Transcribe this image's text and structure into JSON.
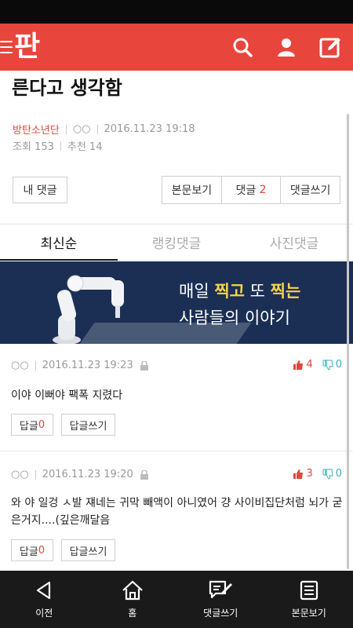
{
  "header": {
    "logo": "판"
  },
  "post": {
    "title": "른다고 생각함",
    "author": "방탄소년단",
    "anon_marks": "○○",
    "datetime": "2016.11.23 19:18",
    "views_label": "조회 153",
    "recommend_label": "추천 14"
  },
  "buttons": {
    "my_comments": "내 댓글",
    "view_post": "본문보기",
    "comments_label": "댓글",
    "comments_count": "2",
    "write_comment": "댓글쓰기"
  },
  "tabs": [
    {
      "label": "최신순"
    },
    {
      "label": "랭킹댓글"
    },
    {
      "label": "사진댓글"
    }
  ],
  "banner": {
    "line1_pre": "매일 ",
    "line1_hl1": "찍고",
    "line1_mid": " 또 ",
    "line1_hl2": "찍는",
    "line2": "사람들의 이야기"
  },
  "comments": [
    {
      "author": "○○",
      "datetime": "2016.11.23 19:23",
      "likes": "4",
      "dislikes": "0",
      "text": "이야 이뻐야 팩폭 지렸다",
      "reply_label": "답글",
      "reply_count": "0",
      "write_reply": "답글쓰기"
    },
    {
      "author": "○○",
      "datetime": "2016.11.23 19:20",
      "likes": "3",
      "dislikes": "0",
      "text": "와 야 일겅 ㅅ발 쟤네는 귀막 빼액이 아니였어 걍 사이비집단처럼 뇌가 굳은거지....(깊은깨달음",
      "reply_label": "답글",
      "reply_count": "0",
      "write_reply": "답글쓰기"
    }
  ],
  "bottom_nav": [
    {
      "label": "이전",
      "icon": "back-triangle-icon"
    },
    {
      "label": "홈",
      "icon": "home-icon"
    },
    {
      "label": "댓글쓰기",
      "icon": "write-comment-icon"
    },
    {
      "label": "본문보기",
      "icon": "document-icon"
    }
  ],
  "colors": {
    "accent": "#e8453c",
    "author": "#e0473e",
    "banner_bg": "#1b2f55",
    "dislike": "#3ab0b6"
  }
}
